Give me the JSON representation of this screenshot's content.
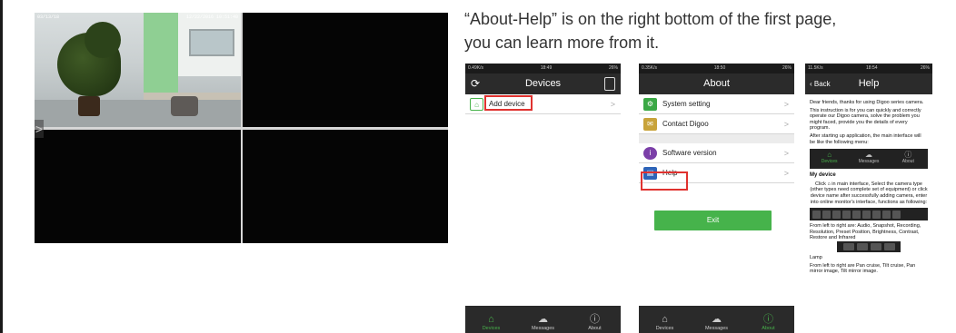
{
  "camera": {
    "osd_left": "03/13/18",
    "osd_right": "12/22/2016 10:51:40",
    "nav_arrow": ">"
  },
  "caption": {
    "line1": "“About-Help” is on the right bottom of the first page,",
    "line2": "you can learn more from it."
  },
  "phone1": {
    "status_left": "0.49K/s",
    "status_time": "18:49",
    "status_right": "26%",
    "title": "Devices",
    "row_label": "Add device",
    "chevron": ">",
    "tabs": [
      {
        "label": "Devices",
        "active": true
      },
      {
        "label": "Messages",
        "active": false
      },
      {
        "label": "About",
        "active": false
      }
    ]
  },
  "phone2": {
    "status_left": "0.35K/s",
    "status_time": "18:50",
    "status_right": "26%",
    "title": "About",
    "rows": [
      "System setting",
      "Contact Digoo",
      "Software version",
      "Help"
    ],
    "chevron": ">",
    "exit_label": "Exit",
    "tabs": [
      {
        "label": "Devices",
        "active": false
      },
      {
        "label": "Messages",
        "active": false
      },
      {
        "label": "About",
        "active": true
      }
    ]
  },
  "phone3": {
    "status_left": "11.5K/s",
    "status_time": "18:54",
    "status_right": "26%",
    "back_label": "Back",
    "title": "Help",
    "intro": "Dear friends, thanks for using Digoo series camera.",
    "intro2": "This instruction is for you can quickly and correctly operate our Digoo camera, solve the problem you might faced, provide you the details of every program.",
    "intro3": "After starting up application, the main interface will be like the following menu:",
    "mini_tabs": [
      "Devices",
      "Messages",
      "About"
    ],
    "heading": "My device",
    "para1": "Click ⌂ in main interface, Select the camera type (other types need complete set of equipment) or click device name after successfully adding camera, enter into online monitor's interface, functions as following:",
    "para2": "From left to right are: Audio, Snapshot, Recording, Resolution, Preset Position, Brightness, Contrast, Restore and Infrared",
    "para3": "Lamp",
    "para4": "From left to right are Pan cruise, Tilt cruise, Pan mirror image, Tilt mirror image."
  },
  "colors": {
    "accent_green": "#46b34b",
    "highlight_red": "#e0322f",
    "bar_dark": "#2b2b2b"
  }
}
